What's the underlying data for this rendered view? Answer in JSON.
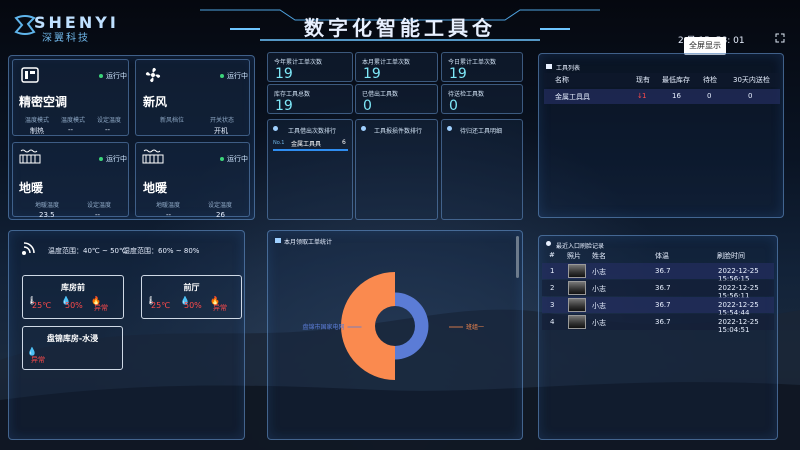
{
  "header": {
    "logo_text": "SHENYI",
    "logo_sub": "深翼科技",
    "title": "数字化智能工具仓",
    "clock": "2 日 15: 58: 01",
    "fullscreen_tip": "全屏显示"
  },
  "devices": [
    {
      "name": "精密空调",
      "status": "运行中",
      "icon": "air-conditioner-icon",
      "fields": [
        {
          "label": "温度模式",
          "value": "制热"
        },
        {
          "label": "温度模式",
          "value": "--"
        },
        {
          "label": "设定温度",
          "value": "--"
        }
      ]
    },
    {
      "name": "新风",
      "status": "运行中",
      "icon": "fan-icon",
      "fields": [
        {
          "label": "新风档位",
          "value": ""
        },
        {
          "label": "开关状态",
          "value": "开机"
        }
      ]
    },
    {
      "name": "地暖",
      "status": "运行中",
      "icon": "floor-heating-icon",
      "fields": [
        {
          "label": "地暖温度",
          "value": "23.5"
        },
        {
          "label": "设定温度",
          "value": "--"
        }
      ]
    },
    {
      "name": "地暖",
      "status": "运行中",
      "icon": "floor-heating-icon",
      "fields": [
        {
          "label": "地暖温度",
          "value": "--"
        },
        {
          "label": "设定温度",
          "value": "26"
        }
      ]
    }
  ],
  "sensors": {
    "temp_range": "温度范围：40℃ ~ 50℃",
    "humidity_range": "湿度范围：60% ~ 80%",
    "rooms": [
      {
        "name": "库房前",
        "temp": "25℃",
        "humidity": "50%",
        "alarm": "异常"
      },
      {
        "name": "前厅",
        "temp": "25℃",
        "humidity": "50%",
        "alarm": "异常"
      },
      {
        "name": "盘锦库房-水浸",
        "alarm": "异常"
      }
    ]
  },
  "stats": [
    {
      "label": "今年累计工单次数",
      "value": "19"
    },
    {
      "label": "本月累计工单次数",
      "value": "19"
    },
    {
      "label": "今日累计工单次数",
      "value": "19"
    },
    {
      "label": "库存工具总数",
      "value": "19"
    },
    {
      "label": "已借出工具数",
      "value": "0"
    },
    {
      "label": "待送检工具数",
      "value": "0"
    }
  ],
  "rankings": {
    "borrow_title": "工具借出次数排行",
    "borrow_rows": [
      {
        "rank": "No.1",
        "name": "金属工具具",
        "count": "6",
        "progress": 1.0
      }
    ],
    "damage_title": "工具报损件数排行",
    "inspect_title": "待归还工具明细"
  },
  "tool_list": {
    "title": "工具列表",
    "headers": [
      "名称",
      "现有",
      "最低库存",
      "待检",
      "30天内送检"
    ],
    "rows": [
      {
        "name": "金属工具具",
        "current": "1",
        "min_stock": "16",
        "pending": "0",
        "due30": "0"
      }
    ]
  },
  "work_order_chart": {
    "title": "本月领取工单统计",
    "chart_data": {
      "type": "pie",
      "subtype": "donut",
      "categories": [
        "盘锦市国家电网",
        "班组一"
      ],
      "values": [
        50,
        50
      ],
      "colors": [
        "#5b7cd6",
        "#fa8a4f"
      ]
    }
  },
  "entry_log": {
    "title": "最近入口刷脸记录",
    "headers": [
      "#",
      "照片",
      "姓名",
      "体温",
      "刷脸时间"
    ],
    "rows": [
      {
        "idx": "1",
        "name": "小志",
        "temp": "36.7",
        "time": "2022-12-25 15:56:15"
      },
      {
        "idx": "2",
        "name": "小志",
        "temp": "36.7",
        "time": "2022-12-25 15:56:11"
      },
      {
        "idx": "3",
        "name": "小志",
        "temp": "36.7",
        "time": "2022-12-25 15:54:44"
      },
      {
        "idx": "4",
        "name": "小志",
        "temp": "36.7",
        "time": "2022-12-25 15:04:51"
      }
    ]
  }
}
